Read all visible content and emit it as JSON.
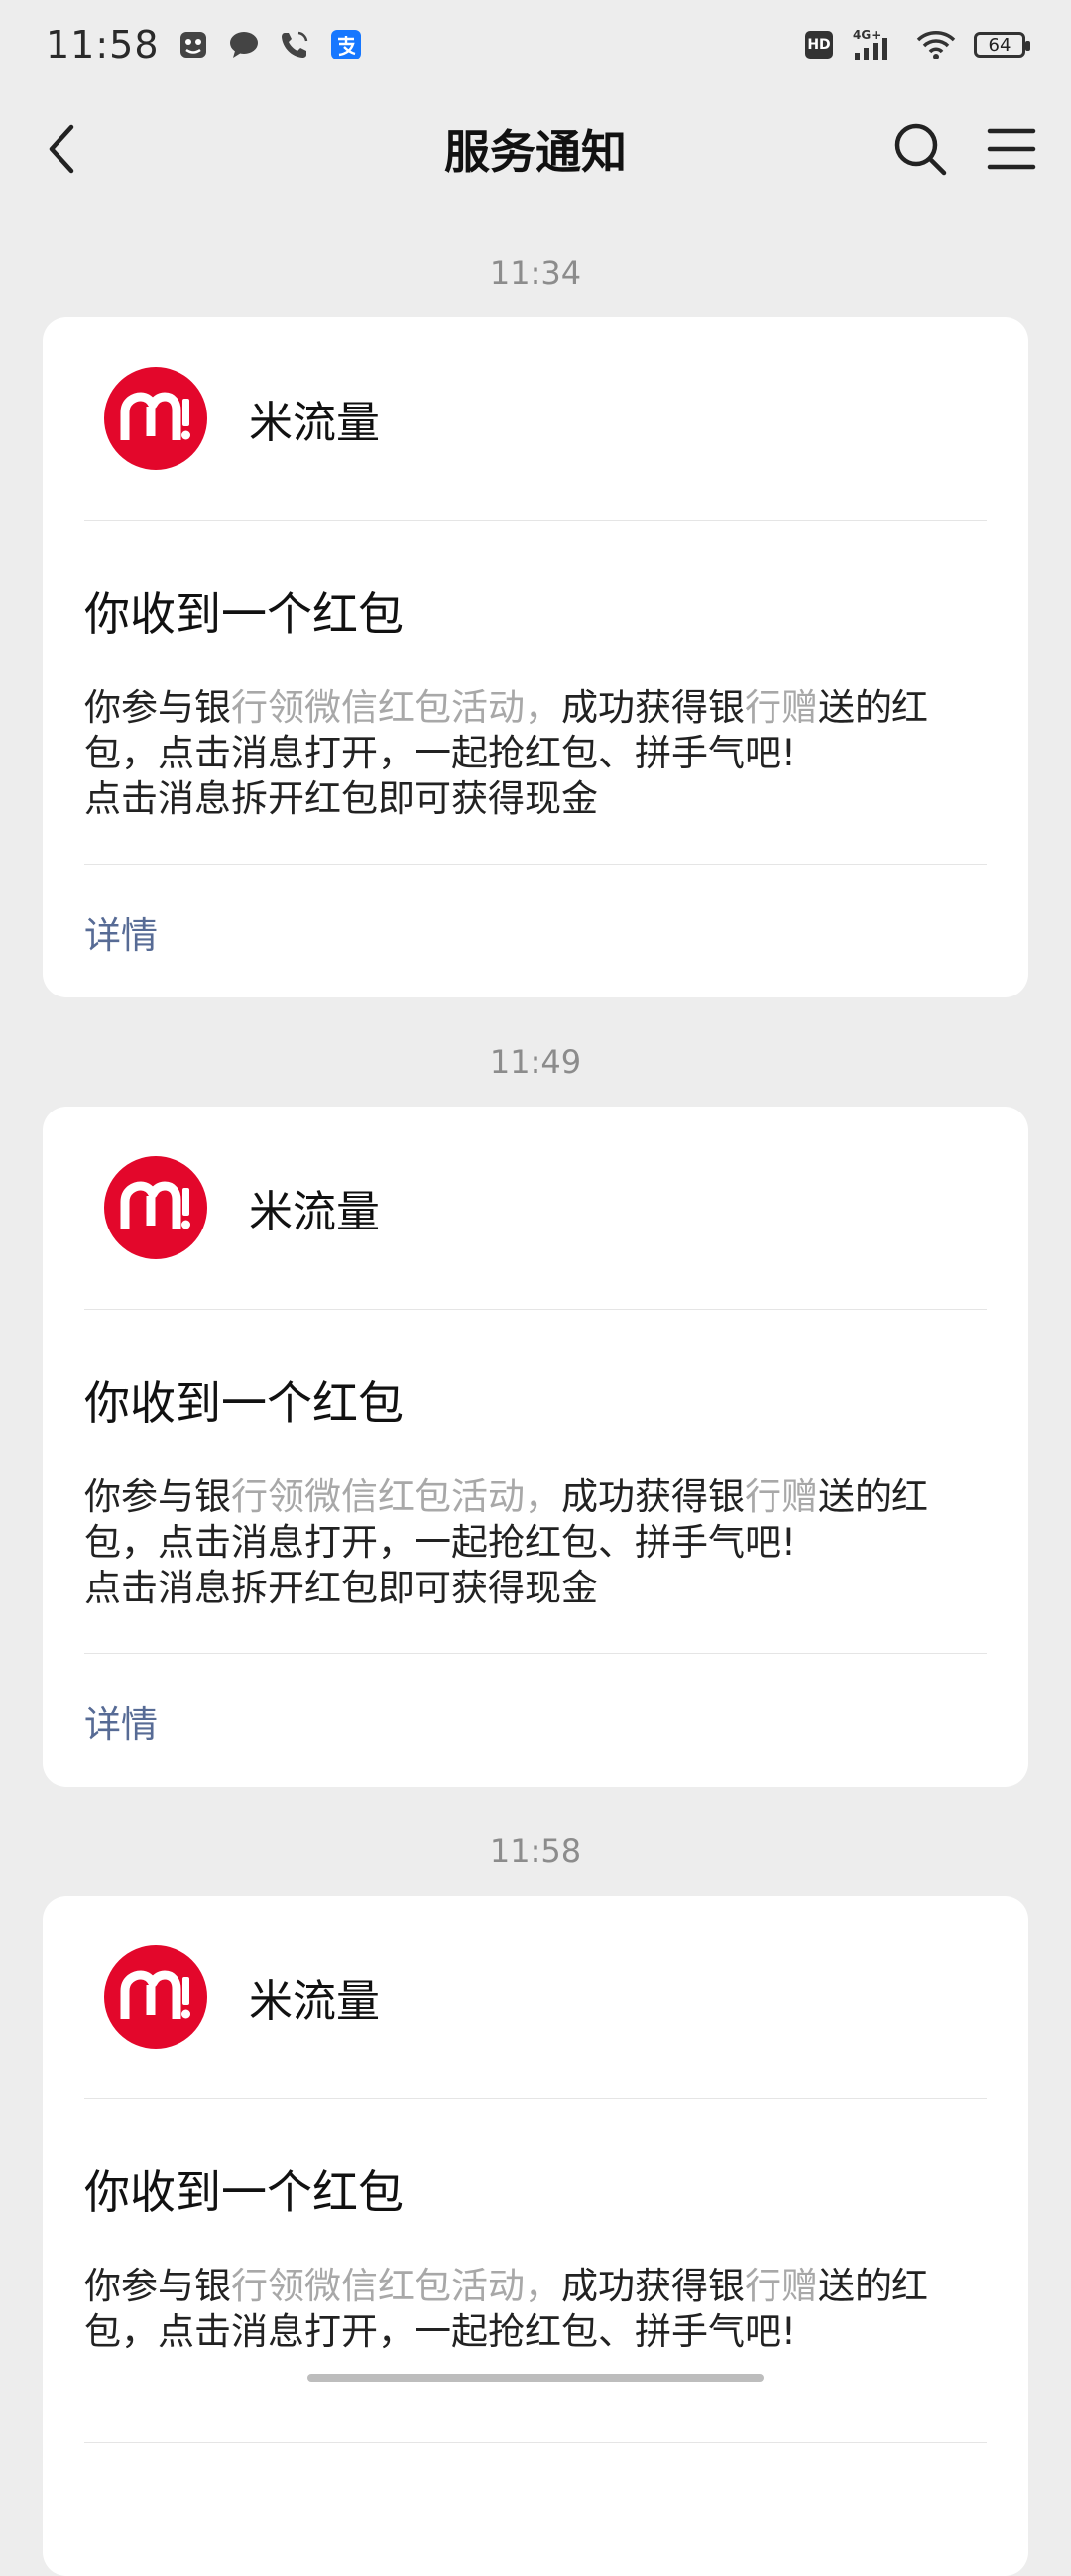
{
  "status_bar": {
    "time": "11:58",
    "network": "4G+",
    "hd": "HD",
    "battery": "64"
  },
  "header": {
    "title": "服务通知"
  },
  "messages": [
    {
      "time": "11:34",
      "sender": "米流量",
      "title": "你收到一个红包",
      "body": {
        "l1a": "你参与银",
        "l1b": "行领微信红包活动，",
        "l1c": "成功获得银",
        "l1d": "行赠",
        "l1e": "送的红",
        "l2": "包，点击消息打开，一起抢红包、拼手气吧!",
        "l3": "点击消息拆开红包即可获得现金"
      },
      "detail_label": "详情"
    },
    {
      "time": "11:49",
      "sender": "米流量",
      "title": "你收到一个红包",
      "body": {
        "l1a": "你参与银",
        "l1b": "行领微信红包活动，",
        "l1c": "成功获得银",
        "l1d": "行赠",
        "l1e": "送的红",
        "l2": "包，点击消息打开，一起抢红包、拼手气吧!",
        "l3": "点击消息拆开红包即可获得现金"
      },
      "detail_label": "详情"
    },
    {
      "time": "11:58",
      "sender": "米流量",
      "title": "你收到一个红包",
      "body": {
        "l1a": "你参与银",
        "l1b": "行领微信红包活动，",
        "l1c": "成功获得银",
        "l1d": "行赠",
        "l1e": "送的红",
        "l2": "包，点击消息打开，一起抢红包、拼手气吧!"
      }
    }
  ],
  "colors": {
    "logo_red": "#e3072b",
    "link": "#576b95",
    "background": "#ededed"
  }
}
